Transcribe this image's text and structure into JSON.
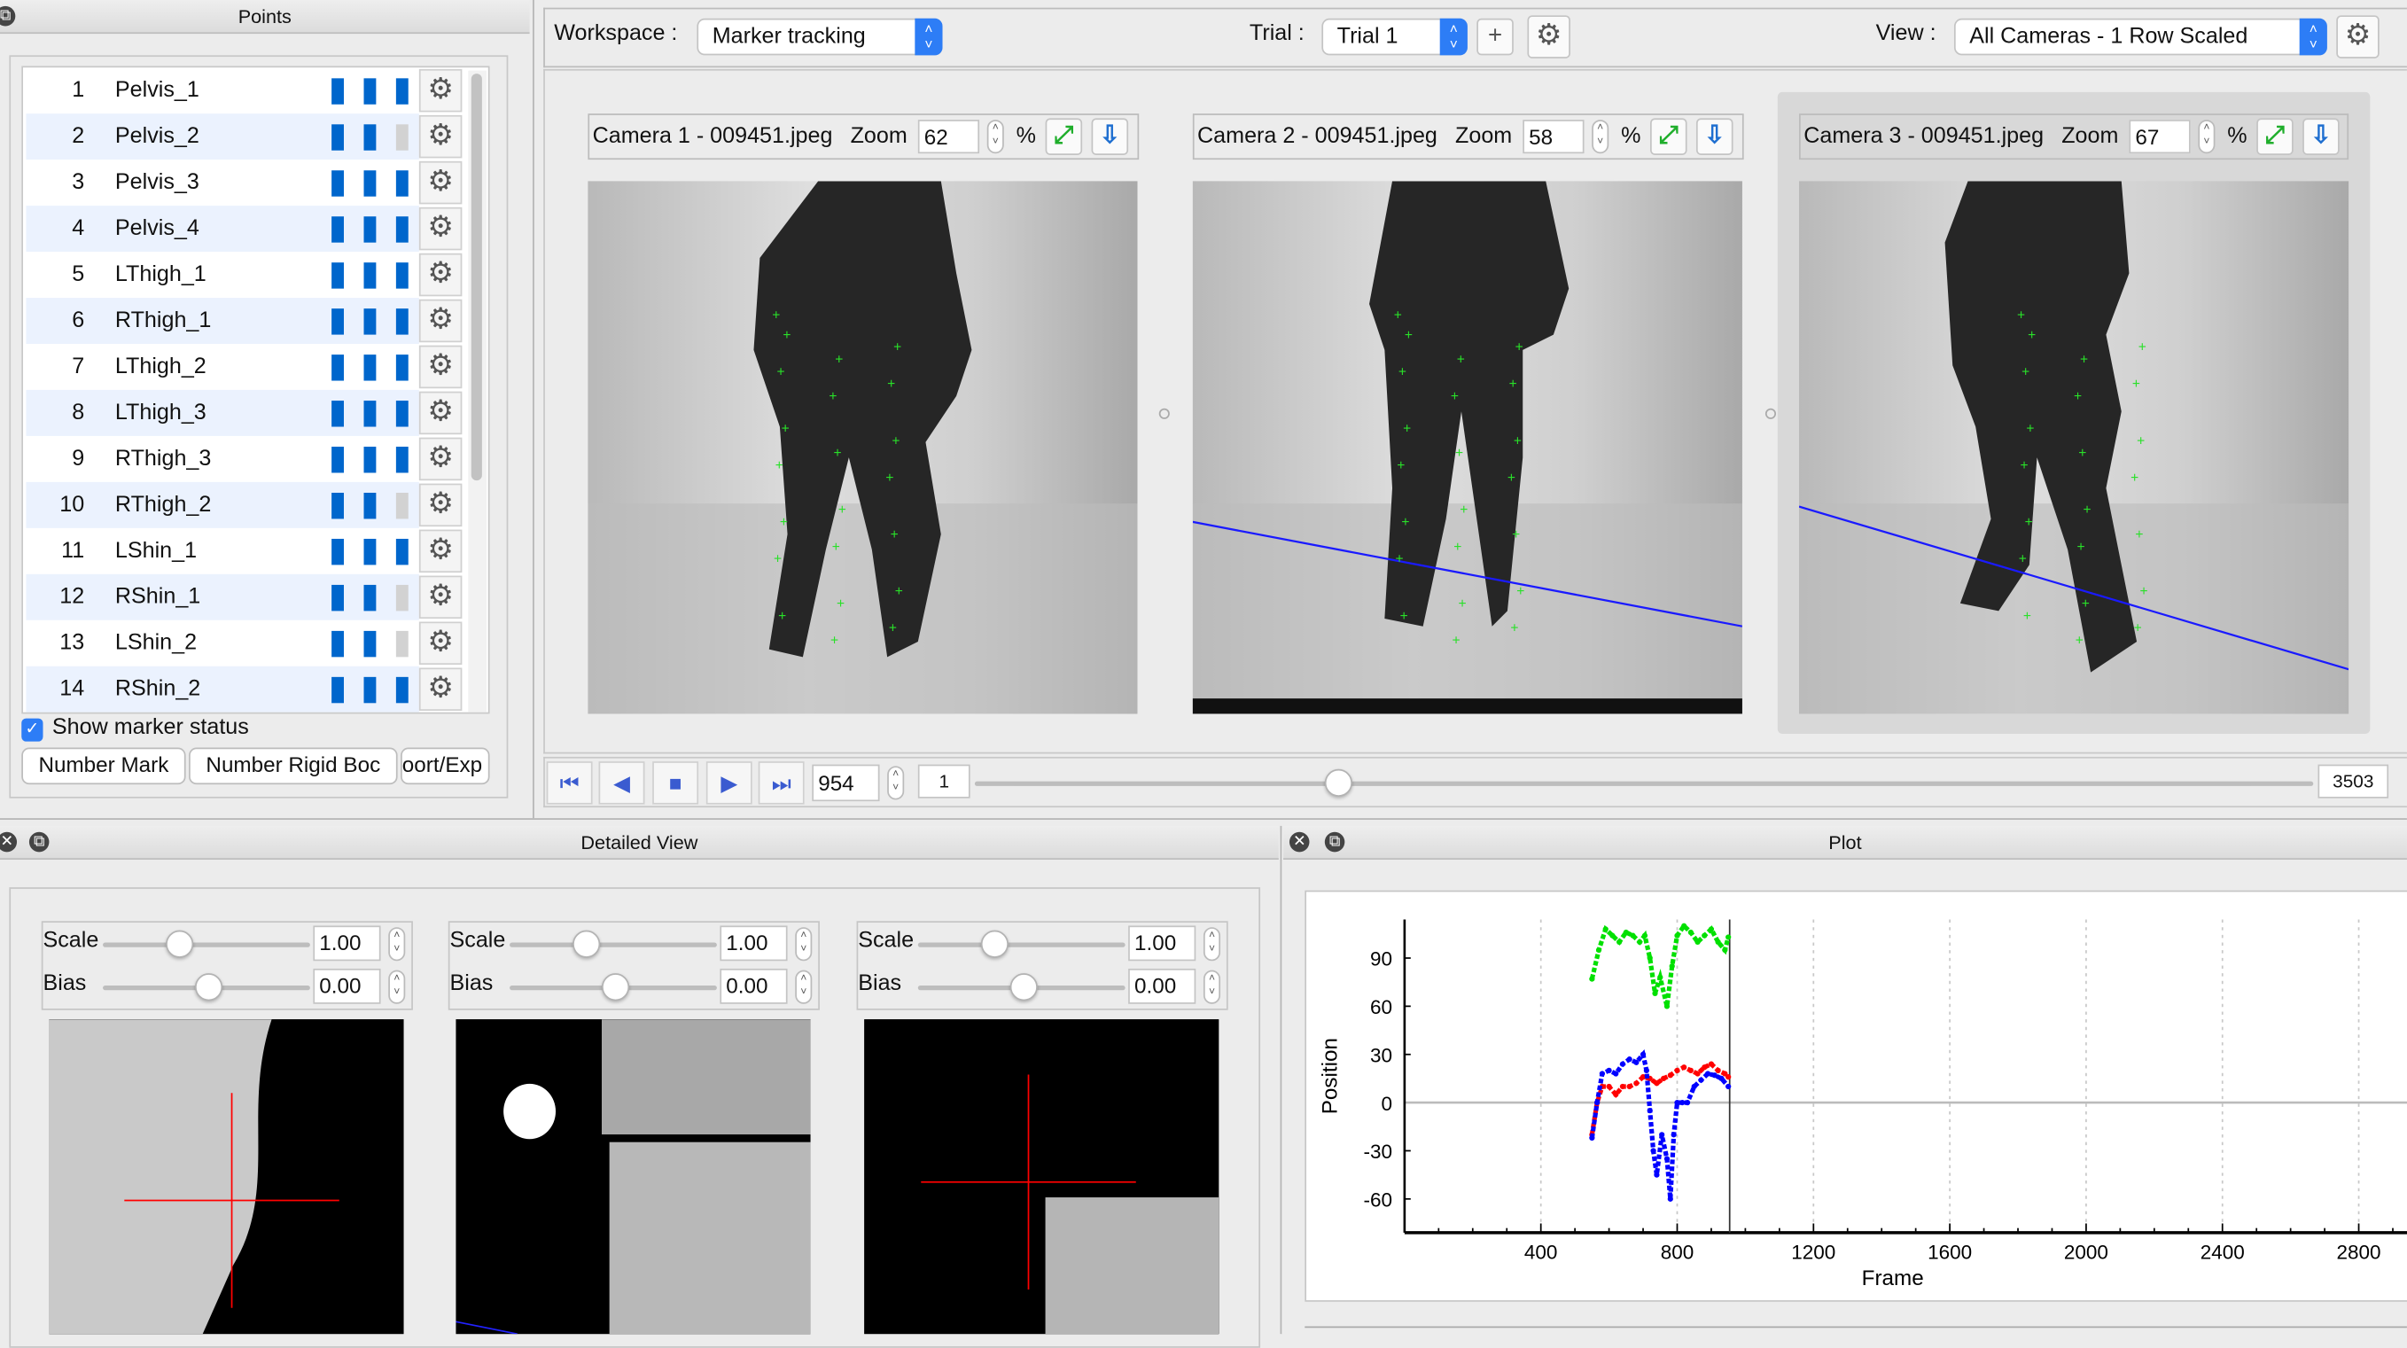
{
  "points_panel": {
    "title": "Points",
    "show_marker_status_label": "Show marker status",
    "show_marker_status_checked": true,
    "rows": [
      {
        "n": "1",
        "name": "Pelvis_1",
        "status": [
          1,
          1,
          1
        ]
      },
      {
        "n": "2",
        "name": "Pelvis_2",
        "status": [
          1,
          1,
          0
        ]
      },
      {
        "n": "3",
        "name": "Pelvis_3",
        "status": [
          1,
          1,
          1
        ]
      },
      {
        "n": "4",
        "name": "Pelvis_4",
        "status": [
          1,
          1,
          1
        ]
      },
      {
        "n": "5",
        "name": "LThigh_1",
        "status": [
          1,
          1,
          1
        ]
      },
      {
        "n": "6",
        "name": "RThigh_1",
        "status": [
          1,
          1,
          1
        ]
      },
      {
        "n": "7",
        "name": "LThigh_2",
        "status": [
          1,
          1,
          1
        ]
      },
      {
        "n": "8",
        "name": "LThigh_3",
        "status": [
          1,
          1,
          1
        ]
      },
      {
        "n": "9",
        "name": "RThigh_3",
        "status": [
          1,
          1,
          1
        ]
      },
      {
        "n": "10",
        "name": "RThigh_2",
        "status": [
          1,
          1,
          0
        ]
      },
      {
        "n": "11",
        "name": "LShin_1",
        "status": [
          1,
          1,
          1
        ]
      },
      {
        "n": "12",
        "name": "RShin_1",
        "status": [
          1,
          1,
          0
        ]
      },
      {
        "n": "13",
        "name": "LShin_2",
        "status": [
          1,
          1,
          0
        ]
      },
      {
        "n": "14",
        "name": "RShin_2",
        "status": [
          1,
          1,
          1
        ]
      }
    ],
    "buttons": [
      "Number Mark",
      "Number Rigid Boc",
      "oort/Exp"
    ]
  },
  "toolbar": {
    "workspace_label": "Workspace :",
    "workspace_value": "Marker tracking",
    "trial_label": "Trial :",
    "trial_value": "Trial 1",
    "add_label": "+",
    "view_label": "View :",
    "view_value": "All Cameras - 1 Row Scaled"
  },
  "cameras": [
    {
      "title": "Camera 1 - 009451.jpeg",
      "zoom_label": "Zoom",
      "zoom": "62",
      "unit": "%"
    },
    {
      "title": "Camera 2 - 009451.jpeg",
      "zoom_label": "Zoom",
      "zoom": "58",
      "unit": "%"
    },
    {
      "title": "Camera 3 - 009451.jpeg",
      "zoom_label": "Zoom",
      "zoom": "67",
      "unit": "%"
    }
  ],
  "playback": {
    "frame": "954",
    "step": "1",
    "max": "3503",
    "position_fraction": 0.272
  },
  "detailed_view": {
    "title": "Detailed View",
    "panels": [
      {
        "scale_label": "Scale",
        "scale": "1.00",
        "bias_label": "Bias",
        "bias": "0.00"
      },
      {
        "scale_label": "Scale",
        "scale": "1.00",
        "bias_label": "Bias",
        "bias": "0.00"
      },
      {
        "scale_label": "Scale",
        "scale": "1.00",
        "bias_label": "Bias",
        "bias": "0.00"
      }
    ]
  },
  "plot_panel": {
    "title": "Plot"
  },
  "chart_data": {
    "type": "scatter",
    "xlabel": "Frame",
    "ylabel": "Position",
    "xlim": [
      0,
      3000
    ],
    "ylim": [
      -81,
      114
    ],
    "xticks": [
      400,
      800,
      1200,
      1600,
      2000,
      2400,
      2800
    ],
    "yticks": [
      -60,
      -30,
      0,
      30,
      60,
      90
    ],
    "grid": "vertical dashed",
    "current_frame": 954,
    "series": [
      {
        "color": "#00e000",
        "x": [
          550,
          570,
          590,
          610,
          630,
          650,
          670,
          690,
          705,
          720,
          735,
          750,
          770,
          785,
          800,
          820,
          840,
          860,
          880,
          900,
          920,
          940,
          950
        ],
        "y": [
          77,
          95,
          108,
          104,
          100,
          106,
          104,
          100,
          104,
          90,
          68,
          78,
          60,
          85,
          104,
          110,
          106,
          100,
          104,
          108,
          100,
          95,
          103
        ]
      },
      {
        "color": "#ff0000",
        "x": [
          550,
          565,
          580,
          600,
          620,
          640,
          660,
          680,
          700,
          720,
          740,
          760,
          780,
          800,
          820,
          840,
          860,
          880,
          900,
          920,
          940,
          950
        ],
        "y": [
          -20,
          0,
          10,
          10,
          5,
          10,
          10,
          12,
          16,
          15,
          12,
          15,
          17,
          20,
          22,
          20,
          18,
          22,
          24,
          20,
          18,
          16
        ]
      },
      {
        "color": "#0000ff",
        "x": [
          550,
          565,
          580,
          600,
          620,
          640,
          660,
          680,
          700,
          710,
          720,
          730,
          740,
          755,
          770,
          780,
          790,
          800,
          815,
          830,
          850,
          870,
          890,
          910,
          930,
          950
        ],
        "y": [
          -22,
          0,
          18,
          20,
          18,
          24,
          27,
          25,
          30,
          20,
          -5,
          -30,
          -45,
          -20,
          -35,
          -60,
          -20,
          0,
          0,
          0,
          10,
          14,
          18,
          17,
          15,
          10
        ]
      }
    ]
  }
}
